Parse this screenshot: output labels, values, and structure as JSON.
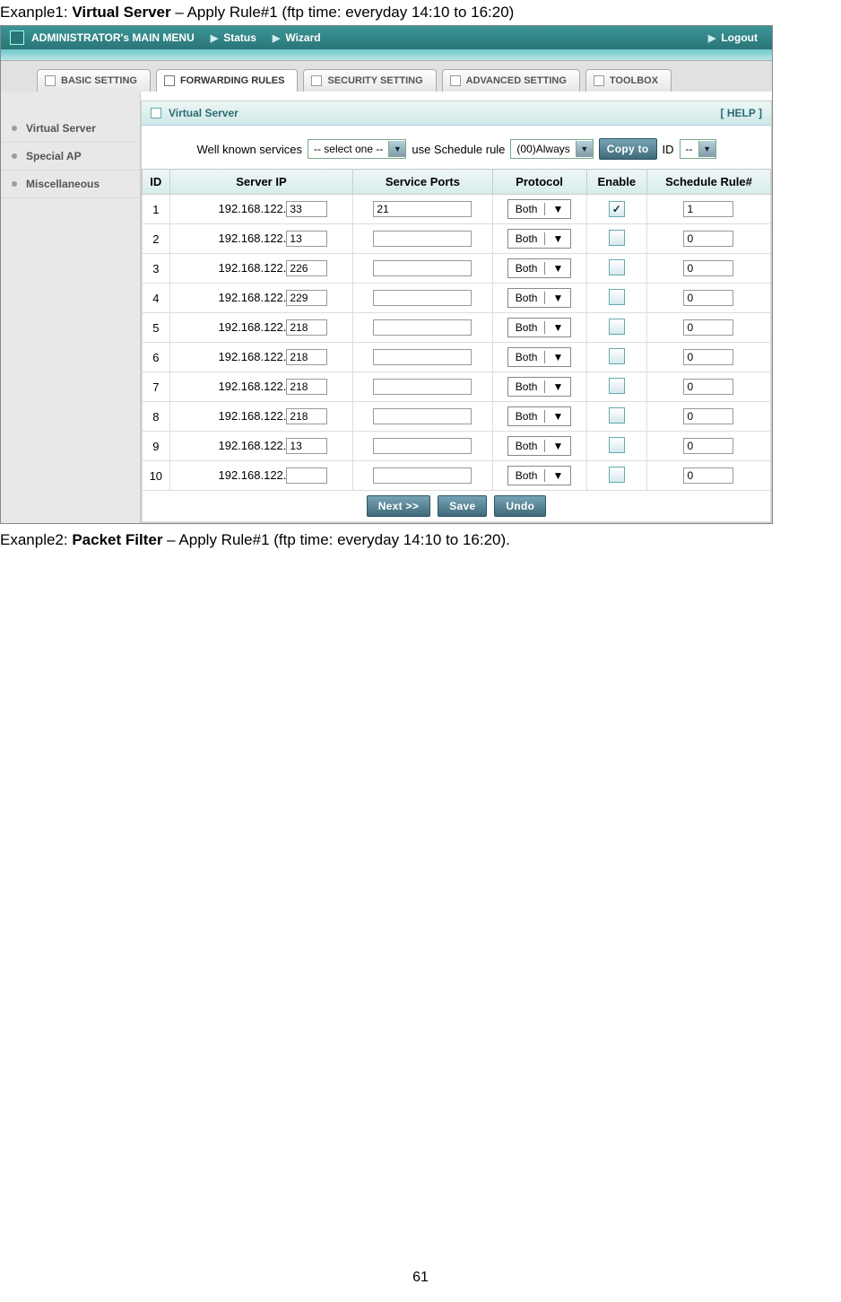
{
  "example1_prefix": "Exanple1: ",
  "example1_bold": "Virtual Server",
  "example1_suffix": " – Apply Rule#1 (ftp time: everyday 14:10 to 16:20)",
  "example2_prefix": "Exanple2: ",
  "example2_bold": "Packet Filter",
  "example2_suffix": " – Apply Rule#1 (ftp time: everyday 14:10 to 16:20).",
  "page_number": "61",
  "topbar": {
    "main_menu": "ADMINISTRATOR's MAIN MENU",
    "status": "Status",
    "wizard": "Wizard",
    "logout": "Logout",
    "arrow": "▶"
  },
  "tabs": {
    "basic": "BASIC SETTING",
    "forwarding": "FORWARDING RULES",
    "security": "SECURITY SETTING",
    "advanced": "ADVANCED SETTING",
    "toolbox": "TOOLBOX"
  },
  "sidebar": {
    "items": [
      "Virtual Server",
      "Special AP",
      "Miscellaneous"
    ]
  },
  "panel": {
    "title": "Virtual Server",
    "help": "[ HELP ]",
    "well_known_label": "Well known services",
    "well_known_value": "-- select one --",
    "use_schedule_label": "use Schedule rule",
    "schedule_value": "(00)Always",
    "copy_to": "Copy to",
    "id_label": "ID",
    "id_value": "--"
  },
  "headers": {
    "id": "ID",
    "server_ip": "Server IP",
    "ports": "Service Ports",
    "protocol": "Protocol",
    "enable": "Enable",
    "schedule": "Schedule Rule#"
  },
  "ip_prefix": "192.168.122.",
  "protocol_label": "Both",
  "rows": [
    {
      "id": "1",
      "ip_oct": "33",
      "port": "21",
      "enabled": true,
      "rule": "1"
    },
    {
      "id": "2",
      "ip_oct": "13",
      "port": "",
      "enabled": false,
      "rule": "0"
    },
    {
      "id": "3",
      "ip_oct": "226",
      "port": "",
      "enabled": false,
      "rule": "0"
    },
    {
      "id": "4",
      "ip_oct": "229",
      "port": "",
      "enabled": false,
      "rule": "0"
    },
    {
      "id": "5",
      "ip_oct": "218",
      "port": "",
      "enabled": false,
      "rule": "0"
    },
    {
      "id": "6",
      "ip_oct": "218",
      "port": "",
      "enabled": false,
      "rule": "0"
    },
    {
      "id": "7",
      "ip_oct": "218",
      "port": "",
      "enabled": false,
      "rule": "0"
    },
    {
      "id": "8",
      "ip_oct": "218",
      "port": "",
      "enabled": false,
      "rule": "0"
    },
    {
      "id": "9",
      "ip_oct": "13",
      "port": "",
      "enabled": false,
      "rule": "0"
    },
    {
      "id": "10",
      "ip_oct": "",
      "port": "",
      "enabled": false,
      "rule": "0"
    }
  ],
  "buttons": {
    "next": "Next >>",
    "save": "Save",
    "undo": "Undo"
  }
}
